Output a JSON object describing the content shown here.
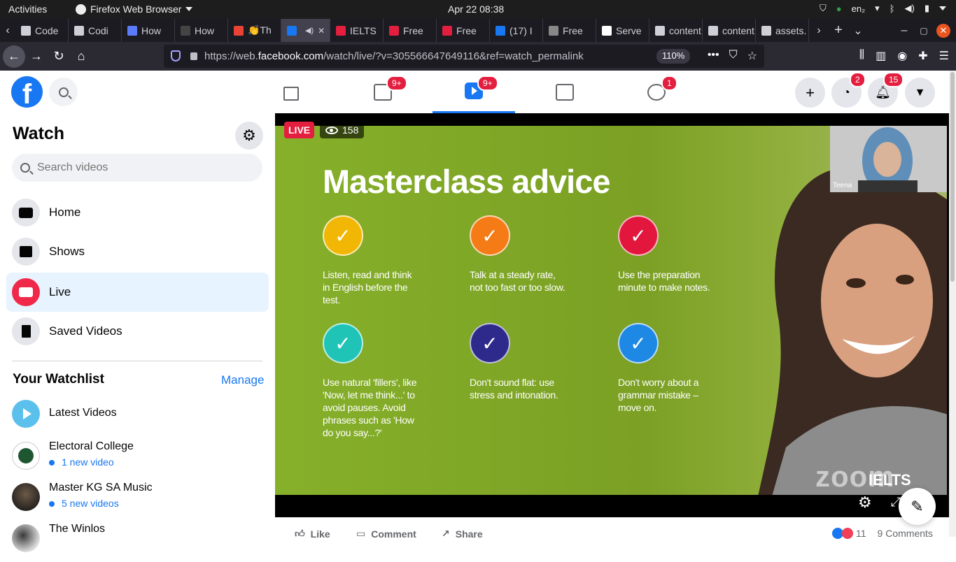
{
  "system": {
    "activities": "Activities",
    "app_name": "Firefox Web Browser",
    "clock": "Apr 22  08:38",
    "lang": "en₂"
  },
  "tabs": [
    {
      "label": "Code",
      "color": "#cfcfd8"
    },
    {
      "label": "Codi",
      "color": "#cfcfd8"
    },
    {
      "label": "How",
      "color": "#5b7cfa"
    },
    {
      "label": "How",
      "color": "#444"
    },
    {
      "label": "👏Th",
      "color": "#ea4335"
    },
    {
      "label": "",
      "color": "#1877f2"
    },
    {
      "label": "IELTS",
      "color": "#e41e3f"
    },
    {
      "label": "Free",
      "color": "#e41e3f"
    },
    {
      "label": "Free",
      "color": "#e41e3f"
    },
    {
      "label": "(17) I",
      "color": "#1877f2"
    },
    {
      "label": "Free",
      "color": "#888"
    },
    {
      "label": "Serve",
      "color": "#fff"
    },
    {
      "label": "content",
      "color": "#cfcfd8"
    },
    {
      "label": "content",
      "color": "#cfcfd8"
    },
    {
      "label": "assets.",
      "color": "#cfcfd8"
    }
  ],
  "urlbar": {
    "url_prefix": "https://web.",
    "url_domain": "facebook.com",
    "url_rest": "/watch/live/?v=305566647649116&ref=watch_permalink",
    "zoom": "110%"
  },
  "header": {
    "logo_letter": "f",
    "badges": {
      "pages": "9+",
      "watch": "9+",
      "groups": "1",
      "messenger": "2",
      "notifications": "15"
    }
  },
  "sidebar": {
    "title": "Watch",
    "search_placeholder": "Search videos",
    "items": [
      {
        "label": "Home"
      },
      {
        "label": "Shows"
      },
      {
        "label": "Live"
      },
      {
        "label": "Saved Videos"
      }
    ],
    "watchlist_title": "Your Watchlist",
    "manage_label": "Manage",
    "watchlist": [
      {
        "name": "Latest Videos",
        "sub": ""
      },
      {
        "name": "Electoral College",
        "sub": "1 new video"
      },
      {
        "name": "Master KG SA Music",
        "sub": "5 new videos"
      },
      {
        "name": "The Winlos",
        "sub": ""
      }
    ]
  },
  "video": {
    "live_label": "LIVE",
    "viewer_count": "158",
    "slide_title": "Masterclass advice",
    "pip_name": "Teena",
    "watermark": "zoom",
    "brand": "IELTS",
    "tips": [
      {
        "text": "Listen, read and think in English before the test.",
        "color": "#f2b705"
      },
      {
        "text": "Talk at a steady rate, not too fast or too slow.",
        "color": "#f47b16"
      },
      {
        "text": "Use the preparation minute to make notes.",
        "color": "#e3173e"
      },
      {
        "text": "Use natural 'fillers', like 'Now, let me think...' to avoid pauses. Avoid phrases such as 'How do you say...?'",
        "color": "#20c4b6"
      },
      {
        "text": "Don't sound flat: use stress and intonation.",
        "color": "#2d2a8c"
      },
      {
        "text": "Don't worry about a grammar mistake – move on.",
        "color": "#1e88e5"
      }
    ]
  },
  "actions": {
    "like": "Like",
    "comment": "Comment",
    "share": "Share",
    "reaction_count": "11",
    "comment_count": "9 Comments"
  }
}
